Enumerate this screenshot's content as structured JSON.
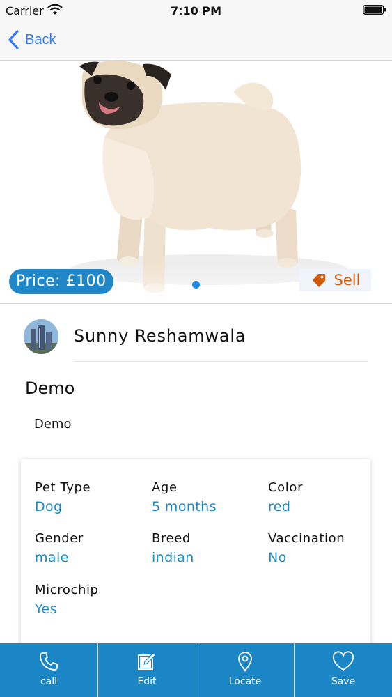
{
  "status_bar": {
    "carrier": "Carrier",
    "time": "7:10 PM"
  },
  "nav": {
    "back_label": "Back"
  },
  "hero": {
    "price": "Price: £100",
    "sell_label": "Sell",
    "page_count": 1,
    "active_page": 1
  },
  "owner": {
    "name": "Sunny Reshamwala"
  },
  "listing": {
    "title": "Demo",
    "description": "Demo"
  },
  "details": [
    {
      "label": "Pet Type",
      "value": "Dog"
    },
    {
      "label": "Age",
      "value": "5 months"
    },
    {
      "label": "Color",
      "value": "red"
    },
    {
      "label": "Gender",
      "value": "male"
    },
    {
      "label": "Breed",
      "value": "indian"
    },
    {
      "label": "Vaccination",
      "value": "No"
    },
    {
      "label": "Microchip",
      "value": "Yes"
    }
  ],
  "tabbar": {
    "call": "call",
    "edit": "Edit",
    "locate": "Locate",
    "save": "Save"
  },
  "colors": {
    "accent": "#1a86c6",
    "value_text": "#1a8bc6",
    "sell": "#d25a0b",
    "ios_blue": "#3478f6"
  }
}
